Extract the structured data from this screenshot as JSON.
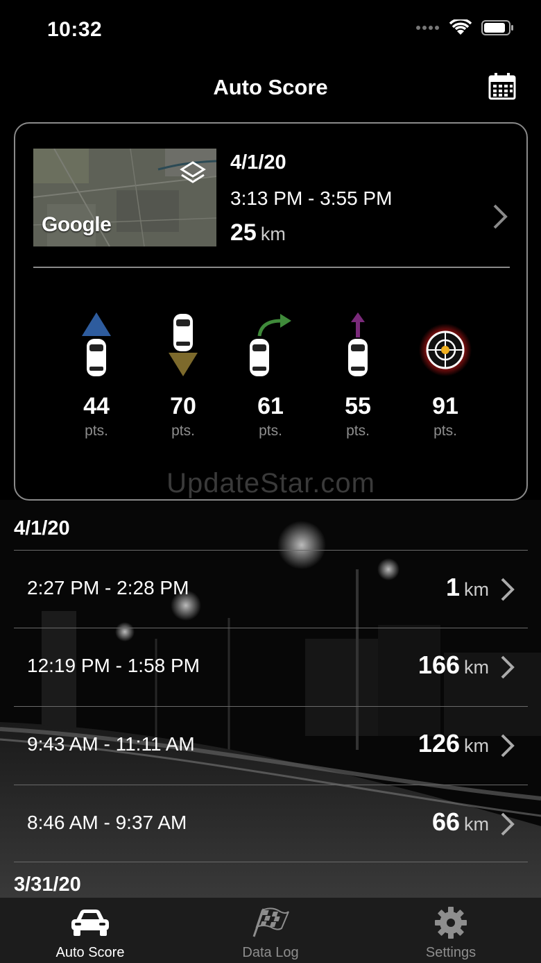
{
  "status_bar": {
    "time": "10:32"
  },
  "nav": {
    "title": "Auto Score"
  },
  "featured_trip": {
    "map_attribution": "Google",
    "date": "4/1/20",
    "time_range": "3:13 PM - 3:55 PM",
    "distance": "25",
    "unit": "km"
  },
  "metrics": [
    {
      "icon": "acceleration-icon",
      "value": "44",
      "label": "pts."
    },
    {
      "icon": "braking-icon",
      "value": "70",
      "label": "pts."
    },
    {
      "icon": "cornering-icon",
      "value": "61",
      "label": "pts."
    },
    {
      "icon": "speed-icon",
      "value": "55",
      "label": "pts."
    },
    {
      "icon": "focus-target-icon",
      "value": "91",
      "label": "pts."
    }
  ],
  "watermark": "UpdateStar.com",
  "sections": [
    {
      "date": "4/1/20",
      "trips": [
        {
          "time_range": "2:27 PM - 2:28 PM",
          "distance": "1",
          "unit": "km"
        },
        {
          "time_range": "12:19 PM - 1:58 PM",
          "distance": "166",
          "unit": "km"
        },
        {
          "time_range": "9:43 AM - 11:11 AM",
          "distance": "126",
          "unit": "km"
        },
        {
          "time_range": "8:46 AM - 9:37 AM",
          "distance": "66",
          "unit": "km"
        }
      ]
    },
    {
      "date": "3/31/20",
      "trips": []
    }
  ],
  "tabs": [
    {
      "label": "Auto Score",
      "icon": "car-icon",
      "active": true
    },
    {
      "label": "Data Log",
      "icon": "checkered-flag-icon",
      "active": false
    },
    {
      "label": "Settings",
      "icon": "gear-icon",
      "active": false
    }
  ],
  "colors": {
    "accel_blue": "#2e5c9e",
    "brake_gold": "#7d6a2c",
    "corner_green": "#3f8a3a",
    "speed_purple": "#7a2a7a",
    "target_red": "#c01818",
    "target_dot": "#f0b020"
  }
}
